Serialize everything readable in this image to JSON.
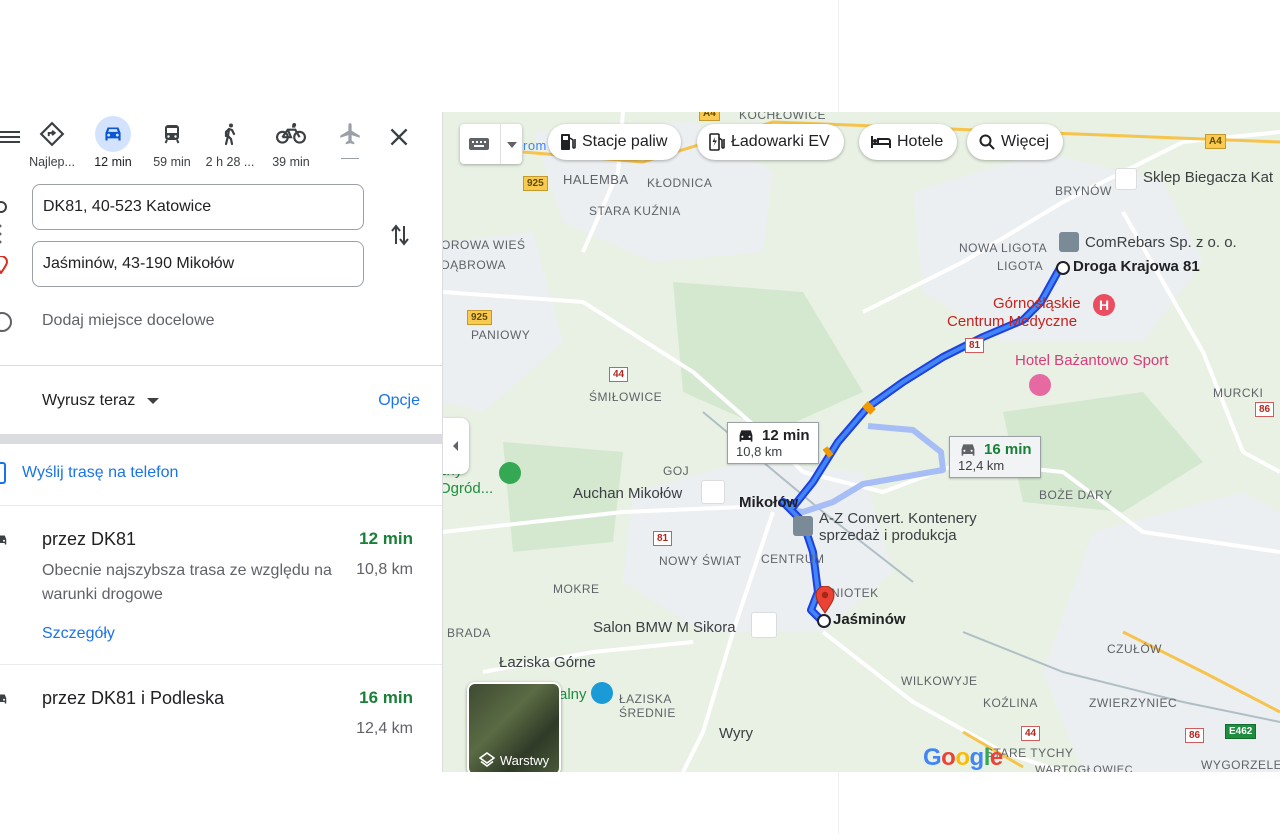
{
  "travel_modes": [
    {
      "label": "Najlep...",
      "icon": "directions-icon"
    },
    {
      "label": "12 min",
      "icon": "car-icon",
      "active": true
    },
    {
      "label": "59 min",
      "icon": "transit-icon"
    },
    {
      "label": "2 h 28 ...",
      "icon": "walk-icon"
    },
    {
      "label": "39 min",
      "icon": "bike-icon"
    },
    {
      "label": "",
      "icon": "plane-icon"
    }
  ],
  "origin": "DK81, 40-523 Katowice",
  "destination": "Jaśminów, 43-190 Mikołów",
  "add_destination": "Dodaj miejsce docelowe",
  "depart": "Wyrusz teraz",
  "options": "Opcje",
  "send_to_phone": "Wyślij trasę na telefon",
  "routes": [
    {
      "name": "przez DK81",
      "time": "12 min",
      "distance": "10,8 km",
      "description": "Obecnie najszybsza trasa ze względu na warunki drogowe",
      "details": "Szczegóły"
    },
    {
      "name": "przez DK81 i Podleska",
      "time": "16 min",
      "distance": "12,4 km"
    }
  ],
  "map": {
    "chips": [
      "Stacje paliw",
      "Ładowarki EV",
      "Hotele",
      "Więcej"
    ],
    "labels": {
      "kochlowice": "KOCHŁOWICE",
      "halemba": "HALEMBA",
      "klodnica": "KŁODNICA",
      "stara_kuznia": "STARA KUŹNIA",
      "brynow": "BRYNÓW",
      "sklep": "Sklep Biegacza Kat",
      "comrebars": "ComRebars Sp. z o. o.",
      "nowa_ligota": "NOWA LIGOTA",
      "ligota": "LIGOTA",
      "droga": "Droga Krajowa 81",
      "orowa_wies": "OROWA WIEŚ",
      "dabrowa": "DĄBROWA",
      "paniowy": "PANIOWY",
      "gcm1": "Górnośląskie",
      "gcm2": "Centrum Medyczne",
      "hotel": "Hotel Bażantowo Sport",
      "smilowice": "ŚMIŁOWICE",
      "murcki": "MURCKI",
      "goj": "GOJ",
      "ogrod1": "zny",
      "ogrod2": "Ogród...",
      "auchan": "Auchan Mikołów",
      "mikolow": "Mikołów",
      "az1": "A-Z Convert. Kontenery",
      "az2": "sprzedaż i produkcja",
      "boze_dary": "BOŻE DARY",
      "nowy_swiat": "NOWY ŚWIAT",
      "centrum": "CENTRUM",
      "mokre": "MOKRE",
      "niotek": "NIOTEK",
      "bmw": "Salon BMW M Sikora",
      "jasminow": "Jaśminów",
      "brada": "BRADA",
      "czulow": "CZUŁÓW",
      "laziska": "Łaziska Górne",
      "alny": "alny",
      "laziska_sr1": "ŁAZISKA",
      "laziska_sr2": "ŚREDNIE",
      "wilkowyje": "WILKOWYJE",
      "kozlina": "KOŹLINA",
      "zwierzyniec": "ZWIERZYNIEC",
      "wyry": "Wyry",
      "stare_tychy": "STARE TYCHY",
      "wartoglowiec": "WARTOGŁOWIEC",
      "wygorzele": "WYGORZELE",
      "rom": "rom"
    },
    "shields": {
      "a4_top": "A4",
      "a4_right": "A4",
      "s925a": "925",
      "s925b": "925",
      "s44a": "44",
      "s44b": "44",
      "s81a": "81",
      "s81b": "81",
      "s81c": "81",
      "s86a": "86",
      "s86b": "86",
      "e462": "E462"
    },
    "route_boxes": [
      {
        "time": "12 min",
        "distance": "10,8 km"
      },
      {
        "time": "16 min",
        "distance": "12,4 km"
      }
    ],
    "layers_label": "Warstwy",
    "google": "Google"
  }
}
